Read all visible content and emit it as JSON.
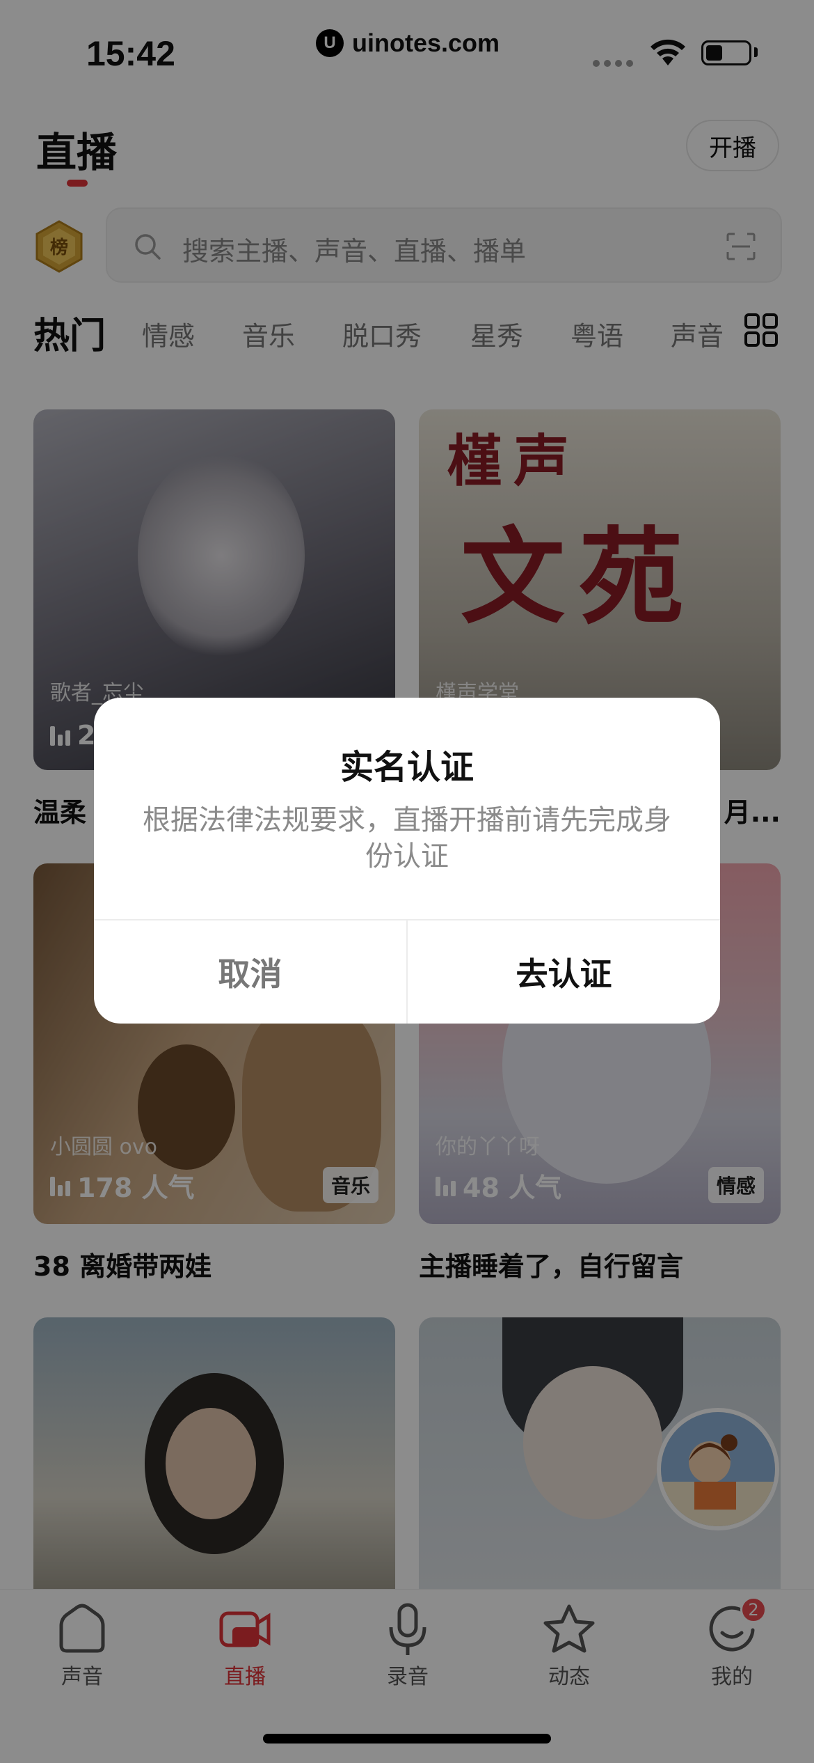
{
  "status_bar": {
    "time": "15:42",
    "watermark": "uinotes.com",
    "watermark_logo": "U"
  },
  "header": {
    "title": "直播",
    "go_live_label": "开播",
    "rank_badge": "榜"
  },
  "search": {
    "placeholder": "搜索主播、声音、直播、播单"
  },
  "categories": [
    "热门",
    "情感",
    "音乐",
    "脱口秀",
    "星秀",
    "粤语",
    "声音"
  ],
  "cards": [
    {
      "host": "歌者_忘尘",
      "popularity": "2",
      "title": "温柔",
      "tag": "",
      "colors": [
        "#a9a9b3",
        "#5d5b66",
        "#2e2f38"
      ]
    },
    {
      "host": "槿声学堂",
      "popularity": "",
      "title": "月...",
      "tag": "",
      "poster_text": [
        "槿声",
        "文苑"
      ],
      "colors": [
        "#e7e2d6",
        "#b9b4a8",
        "#8c877c"
      ]
    },
    {
      "host": "小圆圆 ovo",
      "popularity": "178 人气",
      "title": "38 离婚带两娃",
      "tag": "音乐",
      "colors": [
        "#d9c2a2",
        "#a07e5c",
        "#5c4330"
      ]
    },
    {
      "host": "你的丫丫呀",
      "popularity": "48 人气",
      "title": "主播睡着了，自行留言",
      "tag": "情感",
      "colors": [
        "#f2a9b0",
        "#dcdce8",
        "#b8b4c8"
      ]
    },
    {
      "colors": [
        "#9db2c0",
        "#d8d6cc",
        "#6a6456"
      ]
    },
    {
      "colors": [
        "#cfd8de",
        "#9aa3aa",
        "#e6e9ec"
      ]
    }
  ],
  "tabbar": [
    {
      "label": "声音",
      "icon": "home-icon"
    },
    {
      "label": "直播",
      "icon": "live-camera-icon"
    },
    {
      "label": "录音",
      "icon": "microphone-icon"
    },
    {
      "label": "动态",
      "icon": "star-icon"
    },
    {
      "label": "我的",
      "icon": "profile-icon",
      "badge": "2"
    }
  ],
  "dialog": {
    "title": "实名认证",
    "message": "根据法律法规要求，直播开播前请先完成身份认证",
    "cancel_label": "取消",
    "confirm_label": "去认证"
  },
  "accent_color": "#e0343a"
}
